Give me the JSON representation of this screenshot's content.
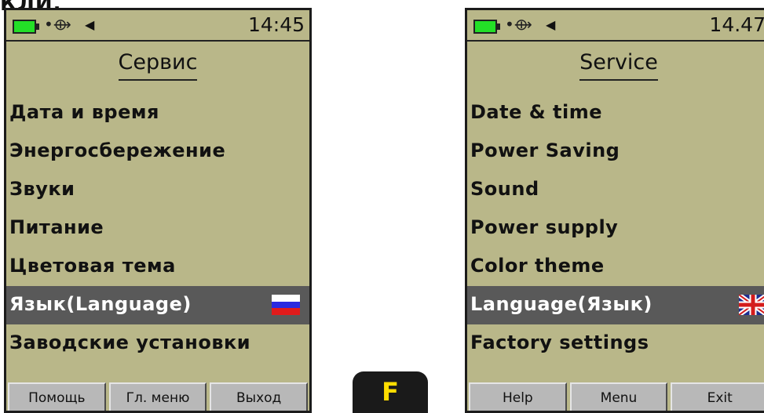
{
  "top_clip_text": "КЛЙ.",
  "left_screen": {
    "status": {
      "time": "14:45",
      "battery_icon": "battery-icon",
      "usb_icon": "usb-icon",
      "sound_icon": "speaker-icon"
    },
    "title": "Сервис",
    "items": [
      {
        "label": "Дата и время"
      },
      {
        "label": "Энергосбережение"
      },
      {
        "label": "Звуки"
      },
      {
        "label": "Питание"
      },
      {
        "label": "Цветовая тема"
      },
      {
        "label": "Язык(Language)",
        "selected": true,
        "flag": "russia-flag-icon"
      },
      {
        "label": "Заводские установки"
      }
    ],
    "softkeys": [
      "Помощь",
      "Гл. меню",
      "Выход"
    ]
  },
  "right_screen": {
    "status": {
      "time": "14.47",
      "battery_icon": "battery-icon",
      "usb_icon": "usb-icon",
      "sound_icon": "speaker-icon"
    },
    "title": "Service",
    "items": [
      {
        "label": "Date & time"
      },
      {
        "label": "Power Saving"
      },
      {
        "label": "Sound"
      },
      {
        "label": "Power supply"
      },
      {
        "label": "Color theme"
      },
      {
        "label": "Language(Язык)",
        "selected": true,
        "flag": "uk-flag-icon"
      },
      {
        "label": "Factory settings"
      }
    ],
    "softkeys": [
      "Help",
      "Menu",
      "Exit"
    ]
  },
  "f_key": {
    "label": "F"
  },
  "colors": {
    "screen_bg": "#b9b789",
    "selection_bg": "#595959",
    "softkey_bg": "#b8b8b8",
    "f_key_text": "#ffdd00",
    "battery": "#23e027"
  }
}
